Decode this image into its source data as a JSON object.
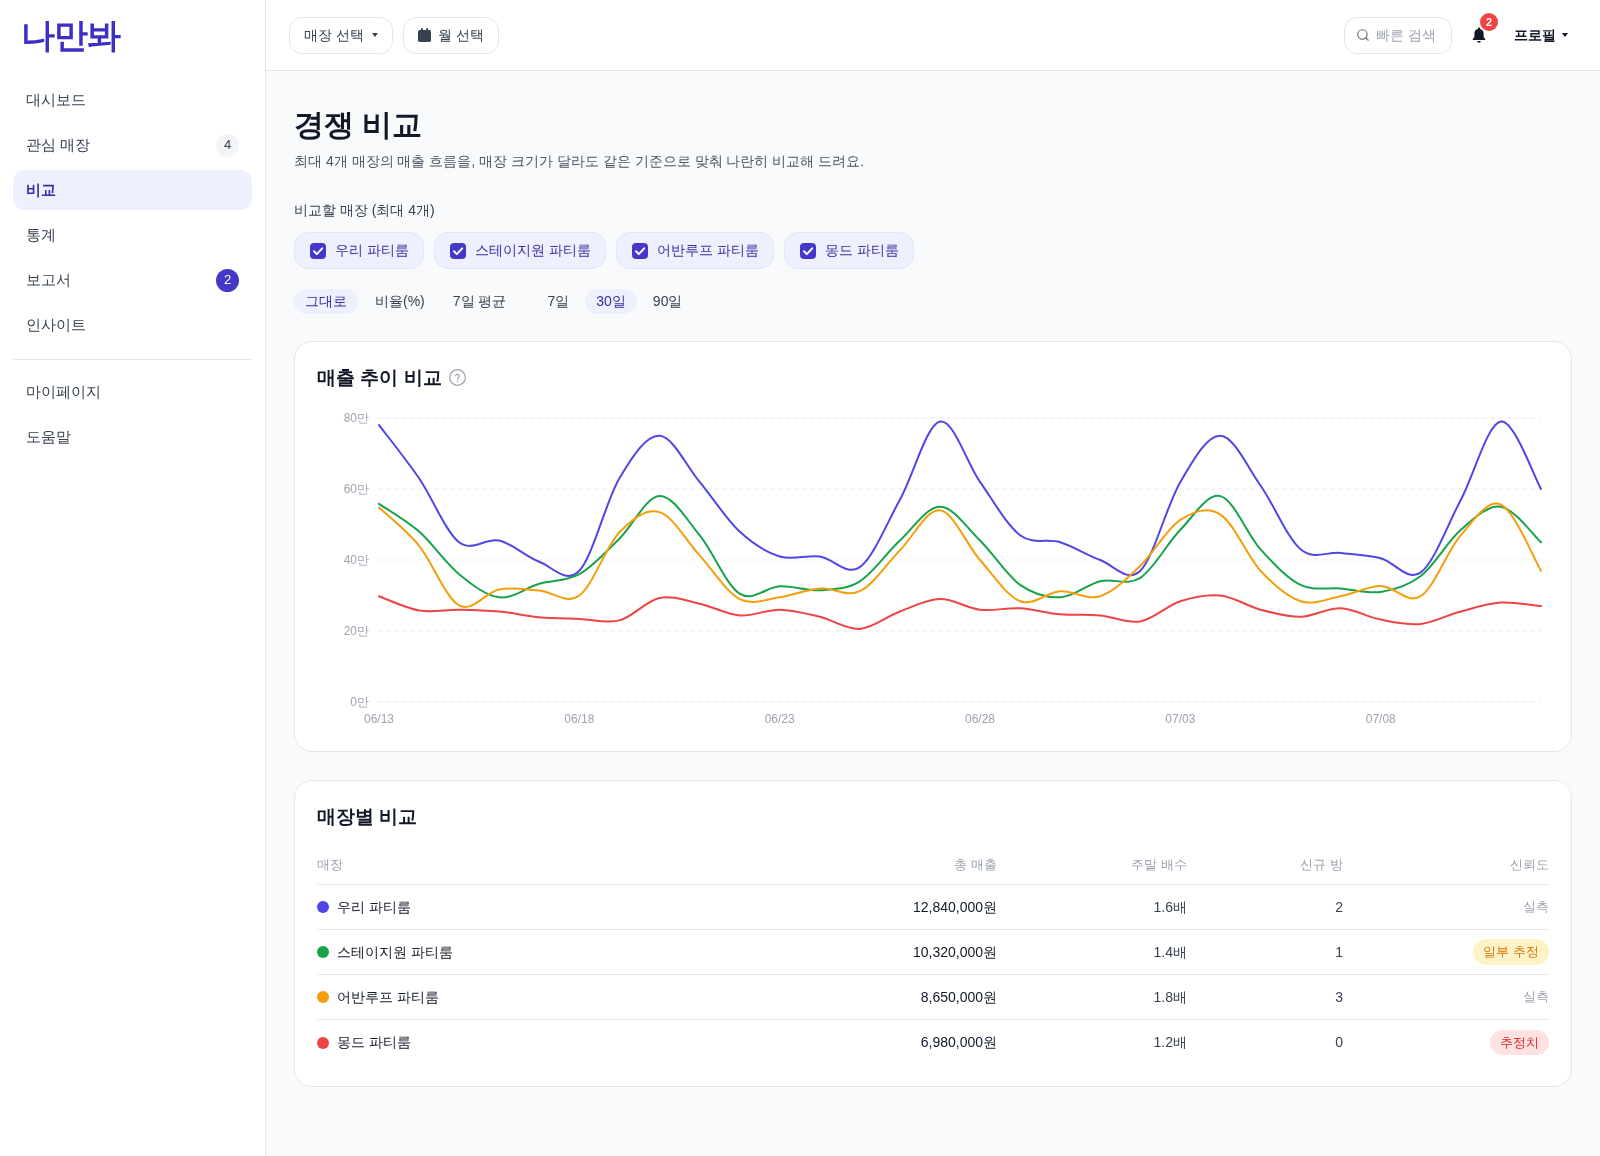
{
  "sidebar": {
    "logo": "나만봐",
    "items": [
      {
        "label": "대시보드",
        "selected": false
      },
      {
        "label": "관심 매장",
        "selected": false,
        "badge": {
          "text": "4",
          "kind": "neutral"
        }
      },
      {
        "label": "비교",
        "selected": true
      },
      {
        "label": "통계",
        "selected": false
      },
      {
        "label": "보고서",
        "selected": false,
        "badge": {
          "text": "2",
          "kind": "accent"
        }
      },
      {
        "label": "인사이트",
        "selected": false
      }
    ],
    "secondary_items": [
      {
        "label": "마이페이지",
        "selected": false
      },
      {
        "label": "도움말",
        "selected": false
      }
    ]
  },
  "header": {
    "store_select": "매장 선택",
    "month_select": "월 선택",
    "search": {
      "placeholder": "빠른 검색"
    },
    "notifications": "2",
    "profile": "프로필"
  },
  "page": {
    "title": "경쟁 비교",
    "subtitle": "최대 4개 매장의 매출 흐름을, 매장 크기가 달라도 같은 기준으로 맞춰 나란히 비교해 드려요."
  },
  "compare": {
    "label": "비교할 매장 (최대 4개)",
    "stores": [
      {
        "label": "우리 파티룸",
        "checked": true
      },
      {
        "label": "스테이지원 파티룸",
        "checked": true
      },
      {
        "label": "어반루프 파티룸",
        "checked": true
      },
      {
        "label": "몽드 파티룸",
        "checked": true
      }
    ]
  },
  "view_modes": [
    {
      "label": "그대로",
      "selected": true
    },
    {
      "label": "비율(%)",
      "selected": false
    },
    {
      "label": "7일 평균",
      "selected": false
    }
  ],
  "periods": [
    {
      "label": "7일",
      "selected": false
    },
    {
      "label": "30일",
      "selected": true
    },
    {
      "label": "90일",
      "selected": false
    }
  ],
  "chart": {
    "title": "매출 추이 비교",
    "chart_data": {
      "type": "line",
      "categories": [
        "06/13",
        null,
        null,
        null,
        null,
        "06/18",
        null,
        null,
        null,
        null,
        "06/23",
        null,
        null,
        null,
        null,
        "06/28",
        null,
        null,
        null,
        null,
        "07/03",
        null,
        null,
        null,
        null,
        "07/08",
        null,
        null,
        null,
        null
      ],
      "series": [
        {
          "color": "#4f46e5",
          "values": [
            78,
            63,
            45,
            45.5,
            39.5,
            37,
            63,
            75,
            62,
            48,
            41,
            41,
            38,
            57,
            79,
            62,
            47,
            45,
            40,
            37,
            62,
            75,
            61,
            43,
            42,
            40.5,
            36.5,
            57,
            79,
            60
          ]
        },
        {
          "color": "#16a34a",
          "values": [
            55.8,
            48,
            36,
            29.5,
            33.3,
            36,
            46,
            58,
            47,
            30.5,
            32.6,
            31.5,
            34,
            45.5,
            55,
            45.5,
            33,
            29.5,
            34,
            35,
            48.5,
            58,
            43,
            33,
            32,
            31,
            35.5,
            48.5,
            55,
            45
          ]
        },
        {
          "color": "#f59e0b",
          "values": [
            54.8,
            44,
            27.2,
            31.7,
            31.4,
            30,
            47.8,
            53.5,
            41.3,
            29,
            29.5,
            32,
            31.2,
            42.7,
            54,
            40,
            28.4,
            31.2,
            29.8,
            38.4,
            51.3,
            52.8,
            37,
            28.4,
            29.8,
            32.7,
            29.8,
            47,
            55.6,
            37
          ]
        },
        {
          "color": "#ef4444",
          "values": [
            29.8,
            25.8,
            26,
            25.5,
            23.9,
            23.4,
            23,
            29.3,
            27.7,
            24.4,
            26,
            24,
            20.6,
            25.5,
            29,
            26,
            26.4,
            24.7,
            24.4,
            22.7,
            28.4,
            30,
            26,
            24,
            26.4,
            23.2,
            22,
            25.5,
            28,
            27
          ]
        }
      ],
      "ylim": [
        0,
        80
      ],
      "yticks": [
        {
          "value": 0,
          "label": "0만"
        },
        {
          "value": 20,
          "label": "20만"
        },
        {
          "value": 40,
          "label": "40만"
        },
        {
          "value": 60,
          "label": "60만"
        },
        {
          "value": 80,
          "label": "80만"
        }
      ],
      "grid": true
    }
  },
  "table": {
    "title": "매장별 비교",
    "columns": [
      "매장",
      "총 매출",
      "주말 배수",
      "신규 방",
      "신뢰도"
    ],
    "rows": [
      {
        "store": "우리 파티룸",
        "color": "#4f46e5",
        "total_sales": "12,840,000원",
        "weekend_ratio": "1.6배",
        "new_rooms": "2",
        "reliability": {
          "label": "실측",
          "kind": "plain"
        }
      },
      {
        "store": "스테이지원 파티룸",
        "color": "#16a34a",
        "total_sales": "10,320,000원",
        "weekend_ratio": "1.4배",
        "new_rooms": "1",
        "reliability": {
          "label": "일부 추정",
          "kind": "warning"
        }
      },
      {
        "store": "어반루프 파티룸",
        "color": "#f59e0b",
        "total_sales": "8,650,000원",
        "weekend_ratio": "1.8배",
        "new_rooms": "3",
        "reliability": {
          "label": "실측",
          "kind": "plain"
        }
      },
      {
        "store": "몽드 파티룸",
        "color": "#ef4444",
        "total_sales": "6,980,000원",
        "weekend_ratio": "1.2배",
        "new_rooms": "0",
        "reliability": {
          "label": "추정치",
          "kind": "danger"
        }
      }
    ]
  }
}
